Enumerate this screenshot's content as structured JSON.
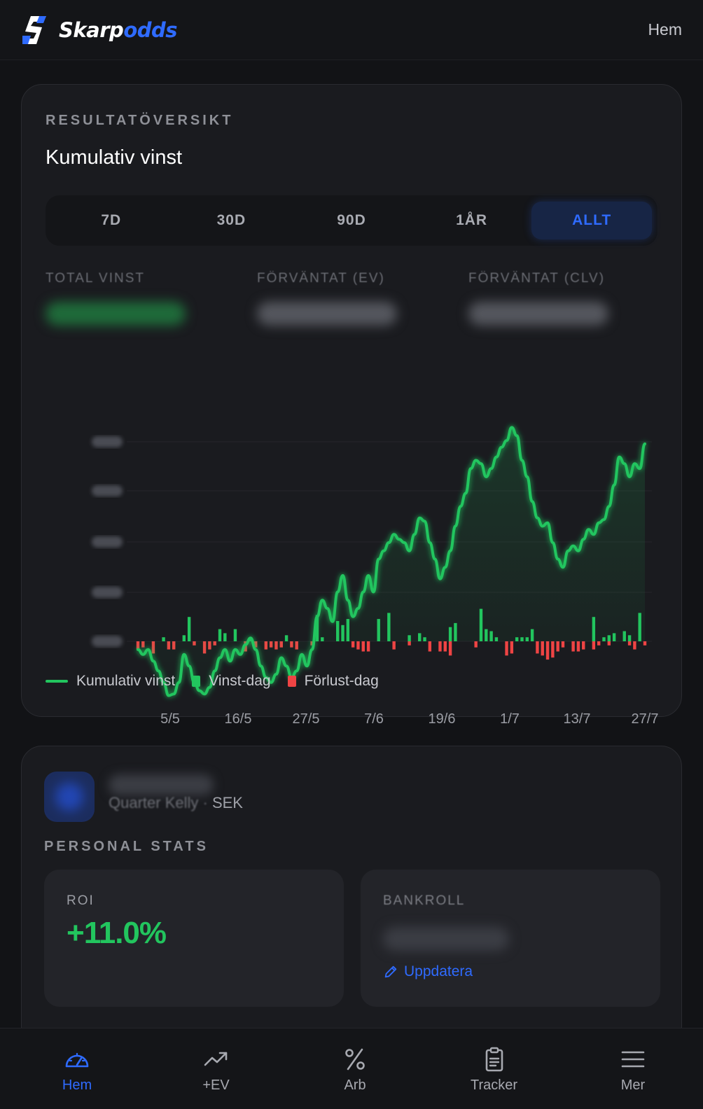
{
  "app": {
    "brand_part1": "Skarp",
    "brand_part2": "odds",
    "header_link": "Hem"
  },
  "overview": {
    "overline": "RESULTATÖVERSIKT",
    "title": "Kumulativ vinst",
    "tabs": [
      {
        "label": "7D",
        "active": false
      },
      {
        "label": "30D",
        "active": false
      },
      {
        "label": "90D",
        "active": false
      },
      {
        "label": "1ÅR",
        "active": false
      },
      {
        "label": "ALLT",
        "active": true
      }
    ],
    "stats": [
      {
        "label": "TOTAL VINST"
      },
      {
        "label": "FÖRVÄNTAT (EV)"
      },
      {
        "label": "FÖRVÄNTAT (CLV)"
      }
    ],
    "legend": {
      "cumulative": "Kumulativ vinst",
      "win_day": "Vinst-dag",
      "loss_day": "Förlust-dag"
    }
  },
  "chart_data": {
    "type": "line",
    "x_tick_labels": [
      "5/5",
      "16/5",
      "27/5",
      "7/6",
      "19/6",
      "1/7",
      "13/7",
      "27/7"
    ],
    "y_tick_labels_hidden": true,
    "grid": true,
    "series": [
      {
        "name": "Kumulativ vinst",
        "type": "line",
        "values": [
          -5,
          -8,
          -5,
          -12,
          -18,
          -25,
          -33,
          -32,
          -25,
          -8,
          -15,
          -25,
          -30,
          -32,
          -28,
          -18,
          -10,
          -5,
          -12,
          -5,
          -8,
          -2,
          2,
          -5,
          -15,
          -22,
          -25,
          -20,
          -10,
          -15,
          -22,
          -18,
          -8,
          -15,
          -5,
          15,
          25,
          20,
          12,
          30,
          40,
          25,
          15,
          20,
          30,
          40,
          30,
          50,
          55,
          60,
          65,
          62,
          60,
          55,
          65,
          75,
          73,
          60,
          50,
          38,
          45,
          55,
          70,
          82,
          90,
          105,
          110,
          108,
          100,
          105,
          112,
          118,
          122,
          130,
          125,
          110,
          100,
          85,
          75,
          70,
          72,
          60,
          50,
          45,
          55,
          58,
          55,
          62,
          68,
          65,
          72,
          74,
          82,
          95,
          112,
          108,
          100,
          108,
          105,
          120
        ]
      },
      {
        "name": "Vinst-dag",
        "type": "bar",
        "color": "#22c55e",
        "values": [
          0,
          0,
          0,
          0,
          0,
          2,
          0,
          0,
          0,
          3,
          12,
          0,
          0,
          0,
          0,
          0,
          6,
          4,
          0,
          6,
          0,
          0,
          2,
          0,
          0,
          0,
          0,
          0,
          0,
          3,
          0,
          0,
          0,
          0,
          0,
          13,
          2,
          0,
          0,
          10,
          8,
          11,
          0,
          0,
          0,
          0,
          0,
          11,
          0,
          14,
          0,
          0,
          0,
          3,
          0,
          4,
          2,
          0,
          0,
          0,
          0,
          7,
          9,
          0,
          0,
          0,
          0,
          16,
          6,
          5,
          2,
          0,
          0,
          0,
          2,
          2,
          2,
          6,
          0,
          0,
          0,
          0,
          0,
          0,
          0,
          0,
          0,
          0,
          0,
          12,
          0,
          2,
          3,
          4,
          0,
          5,
          3,
          0,
          14,
          0,
          0,
          0,
          2,
          8
        ]
      },
      {
        "name": "Förlust-dag",
        "type": "bar",
        "color": "#ef4444",
        "values": [
          -4,
          -3,
          0,
          -6,
          0,
          0,
          -4,
          -4,
          0,
          0,
          0,
          -2,
          0,
          -6,
          -4,
          -2,
          0,
          0,
          0,
          0,
          0,
          -5,
          0,
          -3,
          0,
          -4,
          -3,
          -4,
          -3,
          0,
          -3,
          -4,
          0,
          0,
          -2,
          0,
          0,
          0,
          0,
          0,
          0,
          0,
          -3,
          -4,
          -5,
          -5,
          0,
          0,
          0,
          0,
          -4,
          0,
          0,
          -2,
          0,
          0,
          0,
          -5,
          0,
          -5,
          -5,
          -7,
          0,
          0,
          0,
          0,
          -3,
          0,
          0,
          0,
          0,
          0,
          -7,
          -6,
          0,
          0,
          0,
          0,
          -6,
          -7,
          -9,
          -8,
          -5,
          -3,
          0,
          -5,
          -5,
          -4,
          0,
          -4,
          -2,
          0,
          -2,
          0,
          0,
          0,
          -2,
          -4,
          0,
          -2,
          0,
          -2,
          0,
          0
        ]
      }
    ]
  },
  "profile": {
    "subtitle_blurred": "Quarter Kelly",
    "subtitle_sep": " · ",
    "currency": "SEK",
    "section_label": "PERSONAL STATS",
    "roi_label": "ROI",
    "roi_value": "+11.0%",
    "bankroll_label": "BANKROLL",
    "update_label": "Uppdatera"
  },
  "nav": {
    "items": [
      {
        "label": "Hem",
        "icon": "gauge-icon",
        "active": true
      },
      {
        "label": "+EV",
        "icon": "trending-up-icon",
        "active": false
      },
      {
        "label": "Arb",
        "icon": "percent-icon",
        "active": false
      },
      {
        "label": "Tracker",
        "icon": "clipboard-icon",
        "active": false
      },
      {
        "label": "Mer",
        "icon": "menu-icon",
        "active": false
      }
    ]
  },
  "colors": {
    "accent": "#2f6bff",
    "win": "#22c55e",
    "loss": "#ef4444",
    "background": "#121316",
    "card": "#1a1b1f"
  }
}
